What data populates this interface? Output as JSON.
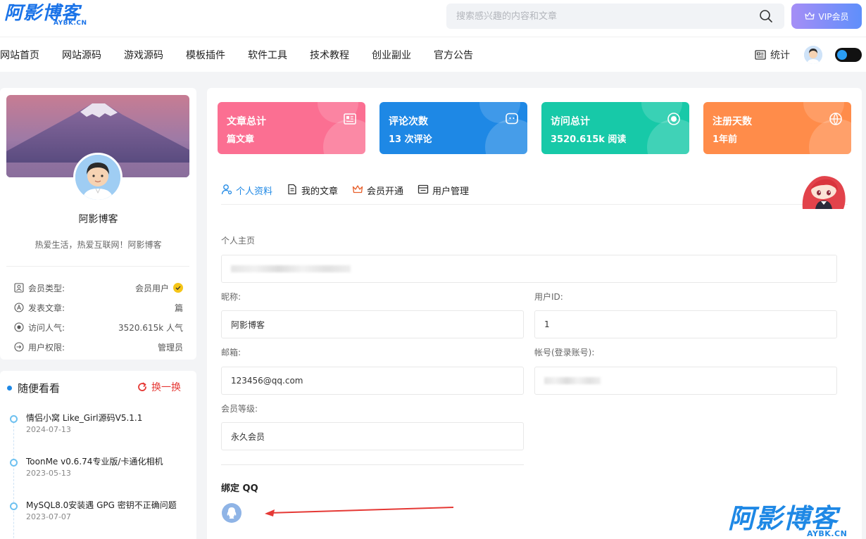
{
  "header": {
    "logo_text": "阿影博客",
    "logo_sub": "AYBK.CN",
    "search_placeholder": "搜索感兴趣的内容和文章",
    "vip_label": "VIP会员"
  },
  "nav": {
    "items": [
      "网站首页",
      "网站源码",
      "游戏源码",
      "模板插件",
      "软件工具",
      "技术教程",
      "创业副业",
      "官方公告"
    ],
    "stats_label": "统计"
  },
  "profile": {
    "name": "阿影博客",
    "signature": "热爱生活，热爱互联网！阿影博客",
    "rows": [
      {
        "label": "会员类型:",
        "value": "会员用户",
        "icon": "id-card-icon"
      },
      {
        "label": "发表文章:",
        "value": "篇",
        "icon": "article-a-icon"
      },
      {
        "label": "访问人气:",
        "value": "3520.615k 人气",
        "icon": "eye-icon"
      },
      {
        "label": "用户权限:",
        "value": "管理员",
        "icon": "permission-icon"
      }
    ]
  },
  "random": {
    "title": "随便看看",
    "refresh_label": "换一换",
    "items": [
      {
        "title": "情侣小窝 Like_Girl源码V5.1.1",
        "date": "2024-07-13"
      },
      {
        "title": "ToonMe v0.6.74专业版/卡通化相机",
        "date": "2023-05-13"
      },
      {
        "title": "MySQL8.0安装遇 GPG 密钥不正确问题",
        "date": "2023-07-07"
      }
    ]
  },
  "stats": [
    {
      "title": "文章总计",
      "value": "篇文章",
      "color": "#fb6f92",
      "icon": "article-icon"
    },
    {
      "title": "评论次数",
      "value": "13 次评论",
      "color": "#1e88e5",
      "icon": "chat-icon"
    },
    {
      "title": "访问总计",
      "value": "3520.615k 阅读",
      "color": "#17c9a8",
      "icon": "eye-icon"
    },
    {
      "title": "注册天数",
      "value": "1年前",
      "color": "#ff8c4a",
      "icon": "globe-icon"
    }
  ],
  "tabs": [
    {
      "label": "个人资料",
      "icon": "user-icon",
      "active": true
    },
    {
      "label": "我的文章",
      "icon": "document-icon",
      "active": false
    },
    {
      "label": "会员开通",
      "icon": "crown-icon",
      "active": false
    },
    {
      "label": "用户管理",
      "icon": "manage-icon",
      "active": false
    }
  ],
  "form": {
    "homepage_label": "个人主页",
    "nickname_label": "昵称:",
    "nickname_value": "阿影博客",
    "userid_label": "用户ID:",
    "userid_value": "1",
    "email_label": "邮箱:",
    "email_value": "123456@qq.com",
    "account_label": "帐号(登录账号):",
    "level_label": "会员等级:",
    "level_value": "永久会员",
    "bind_qq_title": "绑定 QQ"
  },
  "watermark": {
    "main": "阿影博客",
    "sub": "AYBK.CN"
  }
}
